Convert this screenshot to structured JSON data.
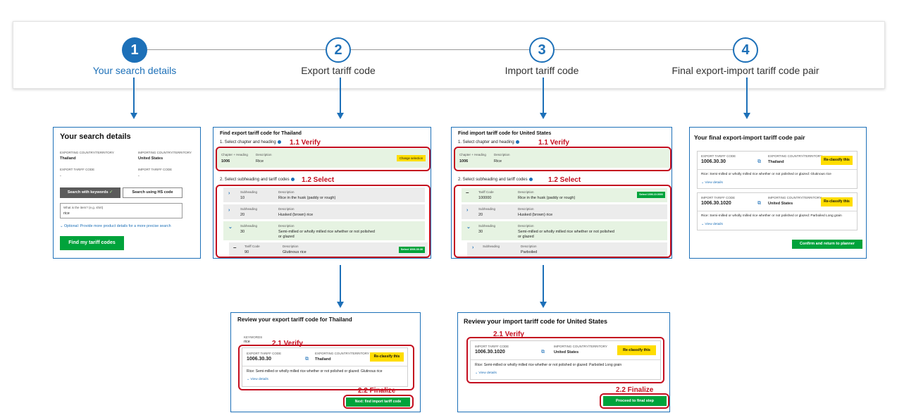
{
  "stepper": {
    "steps": [
      {
        "number": "1",
        "label": "Your search details"
      },
      {
        "number": "2",
        "label": "Export tariff code"
      },
      {
        "number": "3",
        "label": "Import tariff code"
      },
      {
        "number": "4",
        "label": "Final export-import tariff code pair"
      }
    ]
  },
  "search": {
    "title": "Your search details",
    "exporting_label": "EXPORTING COUNTRY/TERRITORY",
    "exporting_value": "Thailand",
    "importing_label": "IMPORTING COUNTRY/TERRITORY",
    "importing_value": "United States",
    "export_code_label": "EXPORT TARIFF CODE",
    "export_code_value": "-",
    "import_code_label": "IMPORT TARIFF CODE",
    "import_code_value": "-",
    "tab_keywords": "Search with keywords",
    "tab_hs": "Search using HS code",
    "item_label": "What is the item? (e.g. shirt)",
    "item_value": "rice",
    "optional_link": "Optional: Provide more product details for a more precise search",
    "submit": "Find my tariff codes"
  },
  "export_find": {
    "title": "Find export tariff code for Thailand",
    "step1": "1. Select chapter and heading",
    "verify_label": "1.1 Verify",
    "chapter_header": "Chapter + Heading",
    "chapter_value": "1006",
    "desc_header": "Description",
    "chapter_desc": "Rice",
    "change_button": "Change selection",
    "step2": "2. Select subheading and tariff codes",
    "select_label": "1.2 Select",
    "sub_header": "Subheading",
    "rows": [
      {
        "code": "10",
        "desc": "Rice in the husk (paddy or rough)"
      },
      {
        "code": "20",
        "desc": "Husked (brown) rice"
      },
      {
        "code": "30",
        "desc": "Semi-milled or wholly milled rice whether or not polished",
        "desc2": "or glazed"
      }
    ],
    "tariff_header": "Tariff Code",
    "tariff_code": "90",
    "tariff_desc": "Glutinous rice",
    "select_button": "Select 1006.30.30"
  },
  "import_find": {
    "title": "Find import tariff code for United States",
    "step1": "1. Select chapter and heading",
    "verify_label": "1.1 Verify",
    "chapter_header": "Chapter + Heading",
    "chapter_value": "1006",
    "desc_header": "Description",
    "chapter_desc": "Rice",
    "step2": "2. Select subheading and tariff codes",
    "select_label": "1.2 Select",
    "tariff_header": "Tariff Code",
    "top_code": "100000",
    "top_desc": "Rice in the husk (paddy or rough)",
    "select_button": "Select 1006.10.0000",
    "sub_header": "Subheading",
    "rows": [
      {
        "code": "20",
        "desc": "Husked (brown) rice"
      },
      {
        "code": "30",
        "desc": "Semi-milled or wholly milled rice whether or not polished",
        "desc2": "or glazed"
      }
    ],
    "bottom_desc": "Parboiled"
  },
  "final": {
    "title": "Your final export-import tariff code pair",
    "export_code_label": "EXPORT TARIFF CODE",
    "export_code": "1006.30.30",
    "exporting_label": "EXPORTING COUNTRY/TERRITORY",
    "exporting_value": "Thailand",
    "reclassify": "Re-classify this",
    "export_desc": "Rice: Semi-milled or wholly milled rice whether or not polished or glazed: Glutinous rice",
    "view_details": "View details",
    "import_code_label": "IMPORT TARIFF CODE",
    "import_code": "1006.30.1020",
    "importing_label": "IMPORTING COUNTRY/TERRITORY",
    "importing_value": "United States",
    "import_desc": "Rice: Semi-milled or wholly milled rice whether or not polished or glazed: Parboiled Long grain",
    "confirm": "Confirm and return to planner"
  },
  "review_export": {
    "title": "Review your export tariff code for Thailand",
    "keywords_label": "KEYWORDS",
    "keywords_value": "rice",
    "verify_label": "2.1 Verify",
    "code_label": "EXPORT TARIFF CODE",
    "code": "1006.30.30",
    "country_label": "EXPORTING COUNTRY/TERRITORY",
    "country": "Thailand",
    "reclassify": "Re-classify this",
    "desc": "Rice: Semi-milled or wholly milled rice whether or not polished or glazed: Glutinous rice",
    "view_details": "View details",
    "finalize_label": "2.2 Finalize",
    "next_button": "Next: find import tariff code"
  },
  "review_import": {
    "title": "Review your import tariff code for United States",
    "verify_label": "2.1 Verify",
    "code_label": "IMPORT TARIFF CODE",
    "code": "1006.30.1020",
    "country_label": "IMPORTING COUNTRY/TERRITORY",
    "country": "United States",
    "reclassify": "Re-classify this",
    "desc": "Rice: Semi-milled or wholly milled rice whether or not polished or glazed: Parboiled Long grain",
    "view_details": "View details",
    "finalize_label": "2.2 Finalize",
    "proceed_button": "Proceed to final step"
  }
}
